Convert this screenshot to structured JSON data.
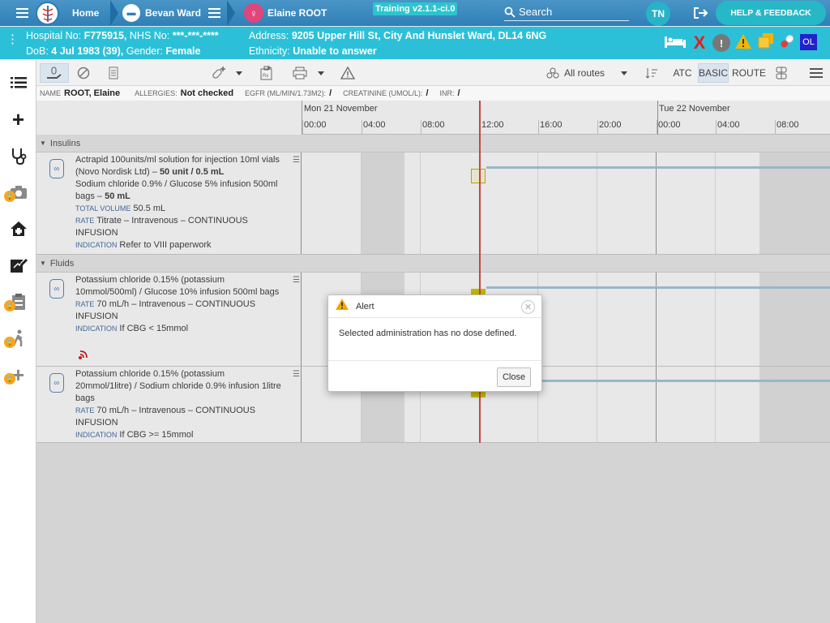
{
  "topbar": {
    "home_label": "Home",
    "ward_label": "Bevan Ward",
    "patient_label": "Elaine ROOT",
    "training_badge": "Training v2.1.1-ci.0",
    "search_label": "Search",
    "user_initials": "TN",
    "help_label": "HELP & FEEDBACK"
  },
  "banner": {
    "hospital_no_label": "Hospital No:",
    "hospital_no": "F775915,",
    "nhs_label": "NHS No:",
    "nhs_no": "***-***-****",
    "dob_label": "DoB:",
    "dob": "4 Jul 1983 (39),",
    "gender_label": "Gender:",
    "gender": "Female",
    "address_label": "Address:",
    "address": "9205 Upper Hill St, City And Hunslet Ward, DL14 6NG",
    "ethnicity_label": "Ethnicity:",
    "ethnicity": "Unable to answer",
    "ol_badge": "OL"
  },
  "toolbar": {
    "routes_label": "All routes",
    "atc_label": "ATC",
    "basic_label": "BASIC",
    "route_label": "ROUTE"
  },
  "summary": {
    "name_label": "NAME",
    "name": "ROOT, Elaine",
    "allergies_label": "ALLERGIES:",
    "allergies": "Not checked",
    "egfr_label": "EGFR (ML/MIN/1.73M2):",
    "egfr": "/",
    "creatinine_label": "CREATININE (UMOL/L):",
    "creatinine": "/",
    "inr_label": "INR:",
    "inr": "/"
  },
  "timeline": {
    "day1": "Mon 21 November",
    "day2": "Tue 22 November",
    "ticks": [
      "00:00",
      "04:00",
      "08:00",
      "12:00",
      "16:00",
      "20:00",
      "00:00",
      "04:00",
      "08:00"
    ]
  },
  "sections": {
    "insulins": "Insulins",
    "fluids": "Fluids"
  },
  "meds": [
    {
      "line1": "Actrapid 100units/ml solution for injection 10ml vials (Novo Nordisk Ltd) –",
      "line1_bold": "50 unit / 0.5 mL",
      "line2": "Sodium chloride 0.9% / Glucose 5% infusion 500ml bags –",
      "line2_bold": "50 mL",
      "total_label": "TOTAL VOLUME",
      "total": "50.5 mL",
      "rate_label": "RATE",
      "rate": "Titrate – Intravenous – CONTINUOUS INFUSION",
      "ind_label": "INDICATION",
      "indication": "Refer to VIII paperwork"
    },
    {
      "line1": "Potassium chloride 0.15% (potassium 10mmol/500ml) / Glucose 10% infusion 500ml bags",
      "rate_label": "RATE",
      "rate": "70 mL/h – Intravenous – CONTINUOUS INFUSION",
      "ind_label": "INDICATION",
      "indication": "If CBG < 15mmol"
    },
    {
      "line1": "Potassium chloride 0.15% (potassium 20mmol/1litre) / Sodium chloride 0.9% infusion 1litre bags",
      "rate_label": "RATE",
      "rate": "70 mL/h – Intravenous – CONTINUOUS INFUSION",
      "ind_label": "INDICATION",
      "indication": "If CBG >= 15mmol"
    }
  ],
  "dialog": {
    "title": "Alert",
    "message": "Selected administration has no dose defined.",
    "close_label": "Close"
  },
  "colors": {
    "nav_blue": "#2f7fb7",
    "banner_teal": "#2cc0d8",
    "warning": "#e7a300",
    "now_line": "#d84c4c"
  }
}
